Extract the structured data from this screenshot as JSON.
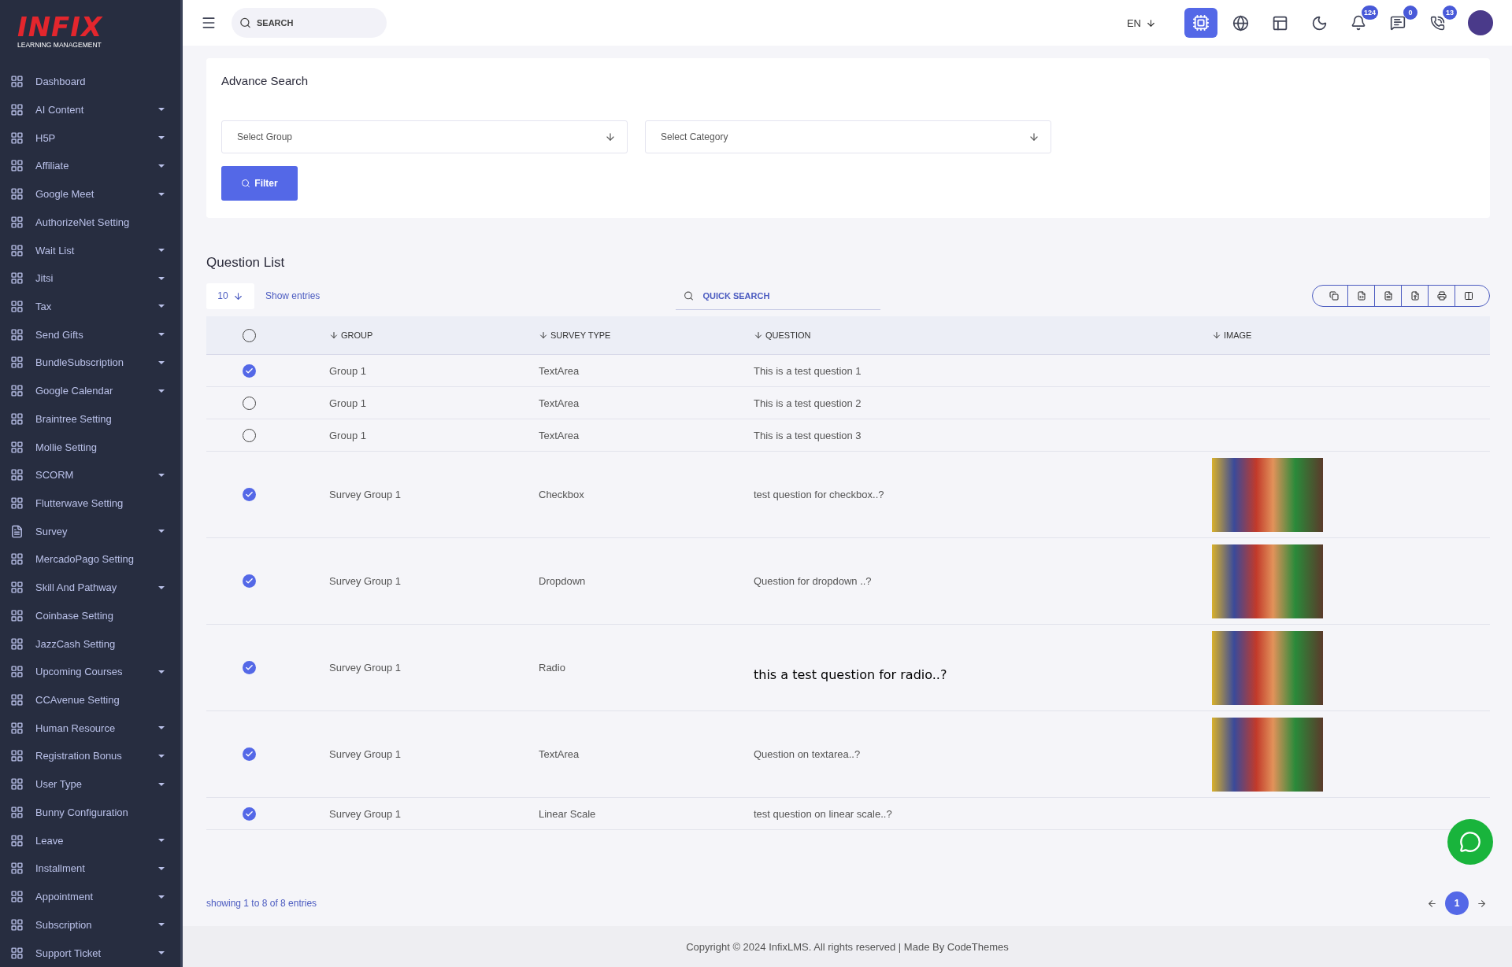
{
  "logo": {
    "title": "INFIX",
    "subtitle": "LEARNING MANAGEMENT"
  },
  "sidebar": {
    "items": [
      {
        "label": "Dashboard",
        "kind": "grid",
        "expandable": false
      },
      {
        "label": "AI Content",
        "kind": "grid",
        "expandable": true
      },
      {
        "label": "H5P",
        "kind": "grid",
        "expandable": true
      },
      {
        "label": "Affiliate",
        "kind": "grid",
        "expandable": true
      },
      {
        "label": "Google Meet",
        "kind": "grid",
        "expandable": true
      },
      {
        "label": "AuthorizeNet Setting",
        "kind": "grid",
        "expandable": false
      },
      {
        "label": "Wait List",
        "kind": "grid",
        "expandable": true
      },
      {
        "label": "Jitsi",
        "kind": "grid",
        "expandable": true
      },
      {
        "label": "Tax",
        "kind": "grid",
        "expandable": true
      },
      {
        "label": "Send Gifts",
        "kind": "grid",
        "expandable": true
      },
      {
        "label": "BundleSubscription",
        "kind": "grid",
        "expandable": true
      },
      {
        "label": "Google Calendar",
        "kind": "grid",
        "expandable": true
      },
      {
        "label": "Braintree Setting",
        "kind": "grid",
        "expandable": false
      },
      {
        "label": "Mollie Setting",
        "kind": "grid",
        "expandable": false
      },
      {
        "label": "SCORM",
        "kind": "grid",
        "expandable": true
      },
      {
        "label": "Flutterwave Setting",
        "kind": "grid",
        "expandable": false
      },
      {
        "label": "Survey",
        "kind": "document",
        "expandable": true
      },
      {
        "label": "MercadoPago Setting",
        "kind": "grid",
        "expandable": false
      },
      {
        "label": "Skill And Pathway",
        "kind": "grid",
        "expandable": true
      },
      {
        "label": "Coinbase Setting",
        "kind": "grid",
        "expandable": false
      },
      {
        "label": "JazzCash Setting",
        "kind": "grid",
        "expandable": false
      },
      {
        "label": "Upcoming Courses",
        "kind": "grid",
        "expandable": true
      },
      {
        "label": "CCAvenue Setting",
        "kind": "grid",
        "expandable": false
      },
      {
        "label": "Human Resource",
        "kind": "grid",
        "expandable": true
      },
      {
        "label": "Registration Bonus",
        "kind": "grid",
        "expandable": true
      },
      {
        "label": "User Type",
        "kind": "grid",
        "expandable": true
      },
      {
        "label": "Bunny Configuration",
        "kind": "grid",
        "expandable": false
      },
      {
        "label": "Leave",
        "kind": "grid",
        "expandable": true
      },
      {
        "label": "Installment",
        "kind": "grid",
        "expandable": true
      },
      {
        "label": "Appointment",
        "kind": "grid",
        "expandable": true
      },
      {
        "label": "Subscription",
        "kind": "grid",
        "expandable": true
      },
      {
        "label": "Support Ticket",
        "kind": "grid",
        "expandable": true
      }
    ]
  },
  "topbar": {
    "search": {
      "placeholder": "SEARCH"
    },
    "language": "EN",
    "icons": [
      {
        "kind": "ai",
        "selected": true
      },
      {
        "kind": "globe",
        "selected": false
      },
      {
        "kind": "layout",
        "selected": false
      },
      {
        "kind": "theme",
        "selected": false
      },
      {
        "kind": "notifications",
        "selected": false,
        "badge": "124"
      },
      {
        "kind": "messages",
        "selected": false,
        "badge": "0"
      },
      {
        "kind": "whatsapp",
        "selected": false,
        "badge": "13"
      }
    ]
  },
  "advance_search": {
    "title": "Advance Search",
    "selects": [
      {
        "placeholder": "Select Group"
      },
      {
        "placeholder": "Select Category"
      }
    ],
    "button": "Filter"
  },
  "question_list": {
    "title": "Question List",
    "page_size": "10",
    "page_size_label": "Show entries",
    "quick_search": {
      "placeholder": "QUICK SEARCH"
    },
    "export_buttons": [
      {
        "kind": "copy"
      },
      {
        "kind": "excel"
      },
      {
        "kind": "csv"
      },
      {
        "kind": "pdf"
      },
      {
        "kind": "print"
      },
      {
        "kind": "columns"
      }
    ],
    "select_all": {
      "checked": false
    },
    "columns": [
      "GROUP",
      "SURVEY TYPE",
      "QUESTION",
      "IMAGE"
    ],
    "rows": [
      {
        "checked": true,
        "group": "Group 1",
        "survey_type": "TextArea",
        "question": "This is a test question 1",
        "handwritten": false,
        "has_image": false
      },
      {
        "checked": false,
        "group": "Group 1",
        "survey_type": "TextArea",
        "question": "This is a test question 2",
        "handwritten": false,
        "has_image": false
      },
      {
        "checked": false,
        "group": "Group 1",
        "survey_type": "TextArea",
        "question": "This is a test question 3",
        "handwritten": false,
        "has_image": false
      },
      {
        "checked": true,
        "group": "Survey Group 1",
        "survey_type": "Checkbox",
        "question": "test question for checkbox..?",
        "handwritten": false,
        "has_image": true
      },
      {
        "checked": true,
        "group": "Survey Group 1",
        "survey_type": "Dropdown",
        "question": "Question for dropdown ..?",
        "handwritten": false,
        "has_image": true
      },
      {
        "checked": true,
        "group": "Survey Group 1",
        "survey_type": "Radio",
        "question": "this a test question for radio..?",
        "handwritten": true,
        "has_image": true
      },
      {
        "checked": true,
        "group": "Survey Group 1",
        "survey_type": "TextArea",
        "question": "Question on textarea..?",
        "handwritten": false,
        "has_image": true
      },
      {
        "checked": true,
        "group": "Survey Group 1",
        "survey_type": "Linear Scale",
        "question": "test question on linear scale..?",
        "handwritten": false,
        "has_image": false
      }
    ],
    "summary": "showing 1 to 8 of 8 entries",
    "pages": [
      {
        "label": "1",
        "selected": true
      }
    ]
  },
  "footer": "Copyright © 2024 InfixLMS. All rights reserved | Made By CodeThemes"
}
